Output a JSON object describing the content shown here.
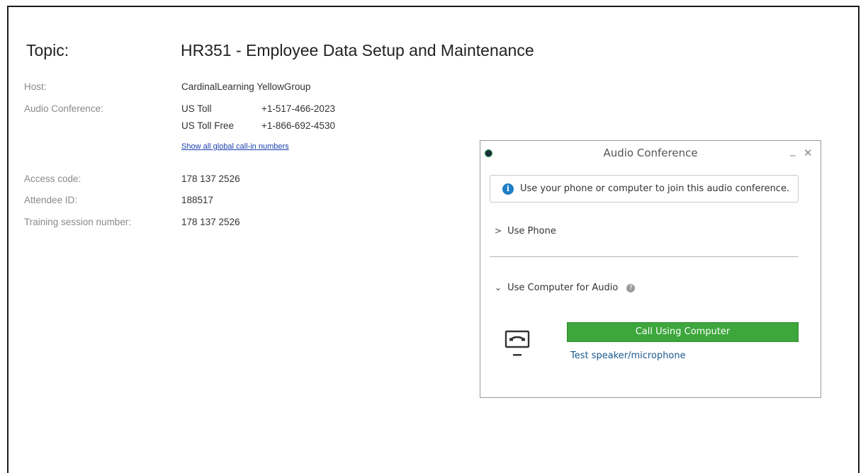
{
  "topic": {
    "label": "Topic:",
    "value": "HR351 - Employee Data Setup and Maintenance"
  },
  "details": {
    "host_label": "Host:",
    "host_value": "CardinalLearning YellowGroup",
    "audio_label": "Audio Conference:",
    "toll_label": "US Toll",
    "toll_number": "+1-517-466-2023",
    "tollfree_label": "US Toll Free",
    "tollfree_number": "+1-866-692-4530",
    "global_link": "Show all global call-in numbers",
    "access_label": "Access code:",
    "access_value": "178 137 2526",
    "attendee_label": "Attendee ID:",
    "attendee_value": "188517",
    "session_label": "Training session number:",
    "session_value": "178 137 2526"
  },
  "dialog": {
    "title": "Audio Conference",
    "minimize": "_",
    "close": "✕",
    "info_text": "Use your phone or computer to join this audio conference.",
    "use_phone": "Use Phone",
    "use_computer": "Use Computer for Audio",
    "call_button": "Call Using Computer",
    "test_link": "Test speaker/microphone"
  },
  "colors": {
    "call_button": "#3da63d",
    "info_icon": "#1e7fc4",
    "link": "#1a3fb0"
  }
}
